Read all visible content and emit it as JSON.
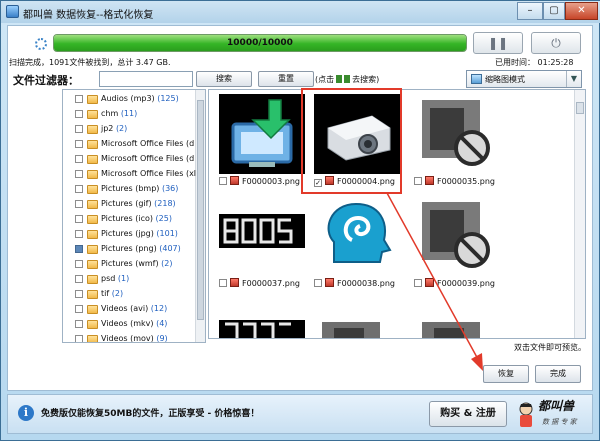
{
  "window": {
    "title": "都叫兽 数据恢复--格式化恢复"
  },
  "scan": {
    "progress_text": "10000/10000",
    "progress_fraction": 1.0,
    "status_left": "扫描完成，1091文件被找到，总计 3.47 GB.",
    "status_right": "已用时间：  01:25:28"
  },
  "filter": {
    "label": "文件过滤器：",
    "input_value": "",
    "search_label": "搜索",
    "reset_label": "重置",
    "hint_pre": "(点击",
    "hint_post": "去搜索)"
  },
  "view": {
    "selected": "缩略图模式"
  },
  "tree": [
    {
      "name": "Audios (mp3)",
      "count": "(125)"
    },
    {
      "name": "chm",
      "count": "(11)"
    },
    {
      "name": "jp2",
      "count": "(2)"
    },
    {
      "name": "Microsoft Office Files (d",
      "count": ""
    },
    {
      "name": "Microsoft Office Files (d",
      "count": ""
    },
    {
      "name": "Microsoft Office Files (xl",
      "count": ""
    },
    {
      "name": "Pictures (bmp)",
      "count": "(36)"
    },
    {
      "name": "Pictures (gif)",
      "count": "(218)"
    },
    {
      "name": "Pictures (ico)",
      "count": "(25)"
    },
    {
      "name": "Pictures (jpg)",
      "count": "(101)"
    },
    {
      "name": "Pictures (png)",
      "count": "(407)",
      "partial": true
    },
    {
      "name": "Pictures (wmf)",
      "count": "(2)"
    },
    {
      "name": "psd",
      "count": "(1)"
    },
    {
      "name": "tif",
      "count": "(2)"
    },
    {
      "name": "Videos (avi)",
      "count": "(12)"
    },
    {
      "name": "Videos (mkv)",
      "count": "(4)"
    },
    {
      "name": "Videos (mov)",
      "count": "(9)"
    }
  ],
  "files": [
    {
      "name": "F0000003.png",
      "checked": false,
      "kind": "monitor-download"
    },
    {
      "name": "F0000004.png",
      "checked": true,
      "kind": "projector"
    },
    {
      "name": "F0000035.png",
      "checked": false,
      "kind": "grey-blocked"
    },
    {
      "name": "F0000037.png",
      "checked": false,
      "kind": "digital-9005"
    },
    {
      "name": "F0000038.png",
      "checked": false,
      "kind": "blue-head"
    },
    {
      "name": "F0000039.png",
      "checked": false,
      "kind": "grey-blocked"
    }
  ],
  "grid_footer": {
    "preview_hint": "双击文件即可预览。"
  },
  "actions": {
    "recover_label": "恢复",
    "finish_label": "完成"
  },
  "bottom": {
    "promo_text": "免费版仅能恢复50MB的文件，正版享受 - 价格惊喜！",
    "buy_label": "购买 & 注册",
    "logo_title": "都叫兽",
    "logo_sub": "数 据 专 家"
  },
  "colors": {
    "accent": "#e23a2a",
    "progress": "#35b526",
    "count": "#1f5fbf"
  }
}
